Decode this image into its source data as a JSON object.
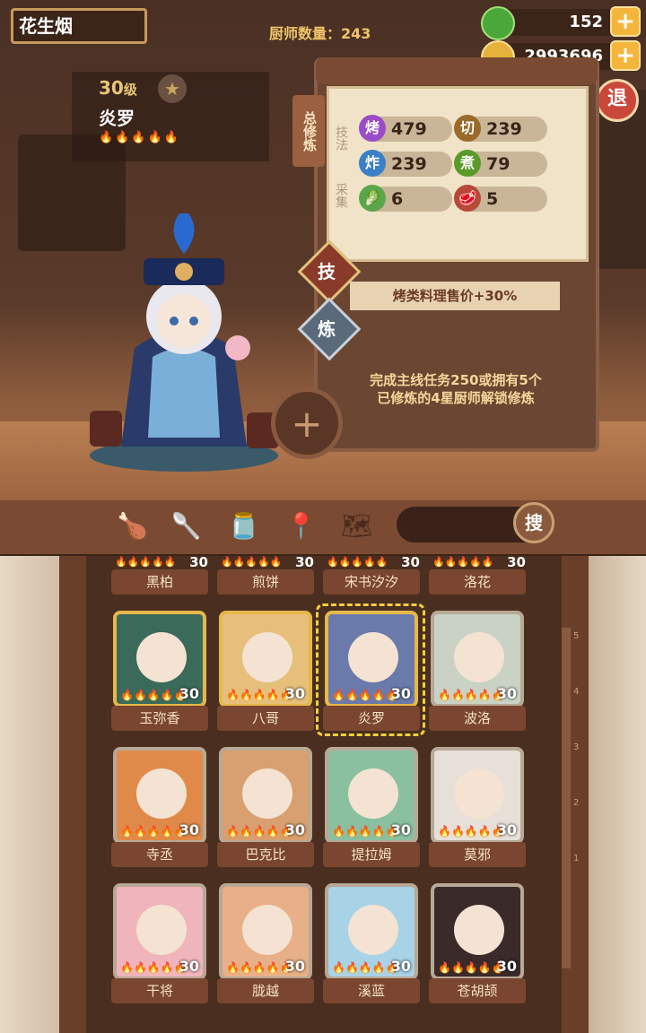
{
  "player": {
    "name": "花生烟"
  },
  "header": {
    "chef_count_label": "厨师数量：",
    "chef_count": "243"
  },
  "currency": {
    "jade": "152",
    "coins": "2993696",
    "plus": "+"
  },
  "exit_label": "退",
  "chef": {
    "level": "30",
    "level_unit": "级",
    "name": "炎罗",
    "flames": "🔥🔥🔥🔥🔥",
    "star": "★"
  },
  "panel": {
    "tab_label": "总修炼",
    "skill_side": "技法",
    "gather_side": "采集",
    "stats": [
      {
        "icon": "烤",
        "value": "479",
        "color": "#9a4bc8"
      },
      {
        "icon": "切",
        "value": "239",
        "color": "#9a6a2a"
      },
      {
        "icon": "炸",
        "value": "239",
        "color": "#3a7fc8"
      },
      {
        "icon": "煮",
        "value": "79",
        "color": "#5a9a2a"
      },
      {
        "icon": "🥬",
        "value": "6",
        "color": "#5aa64a"
      },
      {
        "icon": "🥩",
        "value": "5",
        "color": "#b8483a"
      }
    ],
    "skill_btn": "技",
    "refine_btn": "炼",
    "bonus": "烤类料理售价+30%",
    "unlock_line1": "完成主线任务250或拥有5个",
    "unlock_line2": "已修炼的4星厨师解锁修炼",
    "add": "+"
  },
  "toolbar": {
    "icons": [
      "🍗",
      "🥄",
      "🫙",
      "📍",
      "🗺"
    ],
    "search": "搜"
  },
  "top_row": [
    {
      "name": "黑柏",
      "level": "30"
    },
    {
      "name": "煎饼",
      "level": "30"
    },
    {
      "name": "宋书汐汐",
      "level": "30"
    },
    {
      "name": "洛花",
      "level": "30"
    }
  ],
  "chefs": [
    {
      "name": "玉弥香",
      "level": "30",
      "gold": true,
      "color": "#3a6a5a"
    },
    {
      "name": "八哥",
      "level": "30",
      "gold": true,
      "color": "#e6c07a"
    },
    {
      "name": "炎罗",
      "level": "30",
      "gold": true,
      "color": "#6a7aaa"
    },
    {
      "name": "波洛",
      "level": "30",
      "gold": false,
      "color": "#c9d2c4"
    },
    {
      "name": "寺丞",
      "level": "30",
      "gold": false,
      "color": "#e08a4a"
    },
    {
      "name": "巴克比",
      "level": "30",
      "gold": false,
      "color": "#d8a070"
    },
    {
      "name": "提拉姆",
      "level": "30",
      "gold": false,
      "color": "#8ac0a0"
    },
    {
      "name": "莫邪",
      "level": "30",
      "gold": false,
      "color": "#e6e0d8"
    },
    {
      "name": "干将",
      "level": "30",
      "gold": false,
      "color": "#f0b4bc"
    },
    {
      "name": "胧越",
      "level": "30",
      "gold": false,
      "color": "#e8b088"
    },
    {
      "name": "溪蓝",
      "level": "30",
      "gold": false,
      "color": "#a8d2e6"
    },
    {
      "name": "苍胡颉",
      "level": "30",
      "gold": false,
      "color": "#3a2a2a"
    }
  ],
  "flames_small": "🔥🔥🔥🔥🔥",
  "ruler": [
    "5",
    "4",
    "3",
    "2",
    "1"
  ]
}
